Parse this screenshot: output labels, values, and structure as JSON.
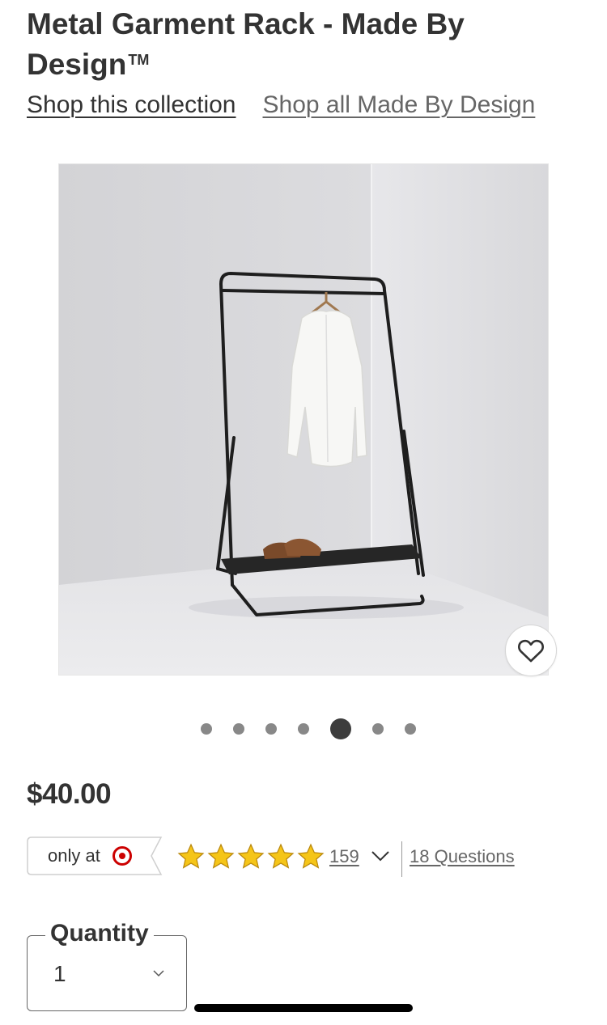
{
  "product": {
    "title": "Metal Garment Rack - Made By Design",
    "trademark": "TM"
  },
  "links": {
    "collection": "Shop this collection",
    "brand": "Shop all Made By Design"
  },
  "gallery": {
    "dot_count": 7,
    "active_index": 4,
    "favorite_icon": "heart-outline-icon"
  },
  "pricing": {
    "price": "$40.00"
  },
  "badge": {
    "only_at": "only at",
    "brand_logo": "target-bullseye-icon",
    "brand_color": "#cc0000"
  },
  "rating": {
    "stars": 5,
    "review_count": "159",
    "questions": "18 Questions",
    "star_color": "#f5c518"
  },
  "quantity": {
    "label": "Quantity",
    "value": "1"
  }
}
